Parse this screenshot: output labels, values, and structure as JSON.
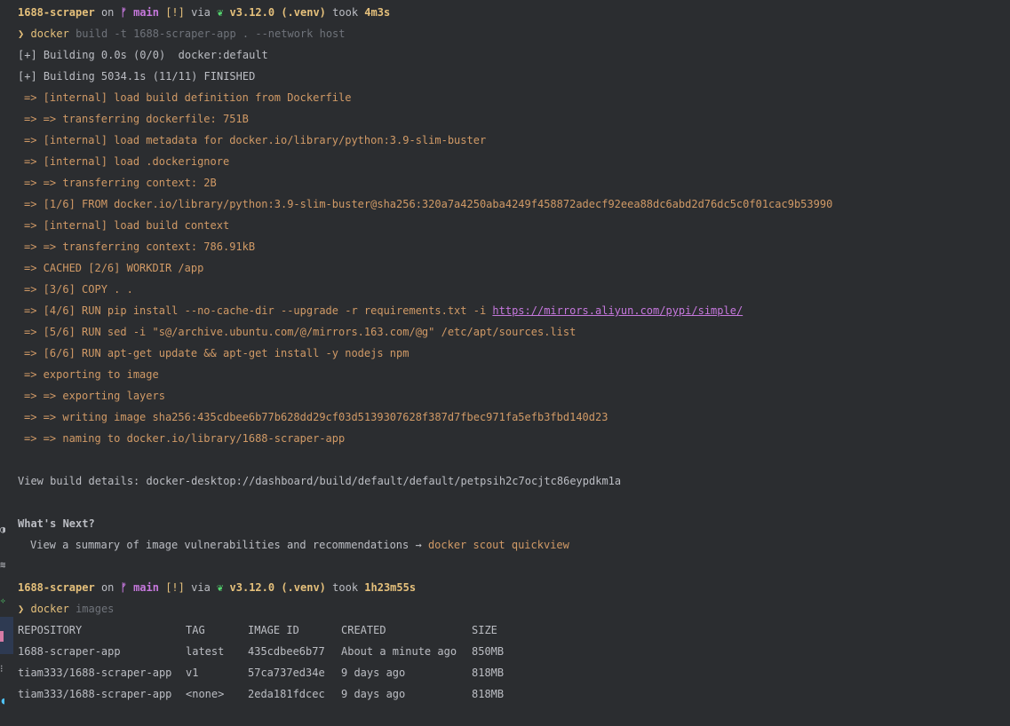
{
  "prompt1": {
    "dir": "1688-scraper",
    "on": "on",
    "branch_icon": "ᚠ",
    "branch": "main",
    "dirty": "[!]",
    "via": "via",
    "py_icon": "❦",
    "py_version": "v3.12.0",
    "venv": "(.venv)",
    "took": "took",
    "duration": "4m3s"
  },
  "command1": {
    "arrow": "❯",
    "cmd": "docker",
    "args": "build -t 1688-scraper-app . --network host"
  },
  "build_output": {
    "building_initial": "[+] Building 0.0s (0/0)  docker:default",
    "building_finished": "[+] Building 5034.1s (11/11) FINISHED",
    "steps": [
      "=> [internal] load build definition from Dockerfile",
      "=> => transferring dockerfile: 751B",
      "=> [internal] load metadata for docker.io/library/python:3.9-slim-buster",
      "=> [internal] load .dockerignore",
      "=> => transferring context: 2B",
      "=> [1/6] FROM docker.io/library/python:3.9-slim-buster@sha256:320a7a4250aba4249f458872adecf92eea88dc6abd2d76dc5c0f01cac9b53990",
      "=> [internal] load build context",
      "=> => transferring context: 786.91kB",
      "=> CACHED [2/6] WORKDIR /app",
      "=> [3/6] COPY . .",
      "=> [4/6] RUN pip install --no-cache-dir --upgrade -r requirements.txt -i ",
      "=> [5/6] RUN sed -i \"s@/archive.ubuntu.com/@/mirrors.163.com/@g\" /etc/apt/sources.list",
      "=> [6/6] RUN apt-get update && apt-get install -y nodejs npm",
      "=> exporting to image",
      "=> => exporting layers",
      "=> => writing image sha256:435cdbee6b77b628dd29cf03d5139307628f387d7fbec971fa5efb3fbd140d23",
      "=> => naming to docker.io/library/1688-scraper-app"
    ],
    "pip_mirror_url": "https://mirrors.aliyun.com/pypi/simple/",
    "view_details": "View build details: docker-desktop://dashboard/build/default/default/petpsih2c7ocjtc86eypdkm1a",
    "whats_next_title": "What's Next?",
    "whats_next_text": "View a summary of image vulnerabilities and recommendations → ",
    "whats_next_cmd": "docker scout quickview"
  },
  "prompt2": {
    "dir": "1688-scraper",
    "on": "on",
    "branch_icon": "ᚠ",
    "branch": "main",
    "dirty": "[!]",
    "via": "via",
    "py_icon": "❦",
    "py_version": "v3.12.0",
    "venv": "(.venv)",
    "took": "took",
    "duration": "1h23m55s"
  },
  "command2": {
    "arrow": "❯",
    "cmd": "docker",
    "args": "images"
  },
  "images_table": {
    "headers": [
      "REPOSITORY",
      "TAG",
      "IMAGE ID",
      "CREATED",
      "SIZE"
    ],
    "rows": [
      [
        "1688-scraper-app",
        "latest",
        "435cdbee6b77",
        "About a minute ago",
        "850MB"
      ],
      [
        "tiam333/1688-scraper-app",
        "v1",
        "57ca737ed34e",
        "9 days ago",
        "818MB"
      ],
      [
        "tiam333/1688-scraper-app",
        "<none>",
        "2eda181fdcec",
        "9 days ago",
        "818MB"
      ]
    ]
  },
  "colors": {
    "background": "#2b2d30",
    "text": "#bcbec4",
    "accent_yellow": "#e5c07b",
    "accent_orange": "#d19a66",
    "accent_purple": "#c678dd",
    "accent_green": "#55d66f",
    "sidebar_marker": "#d67ba6"
  }
}
